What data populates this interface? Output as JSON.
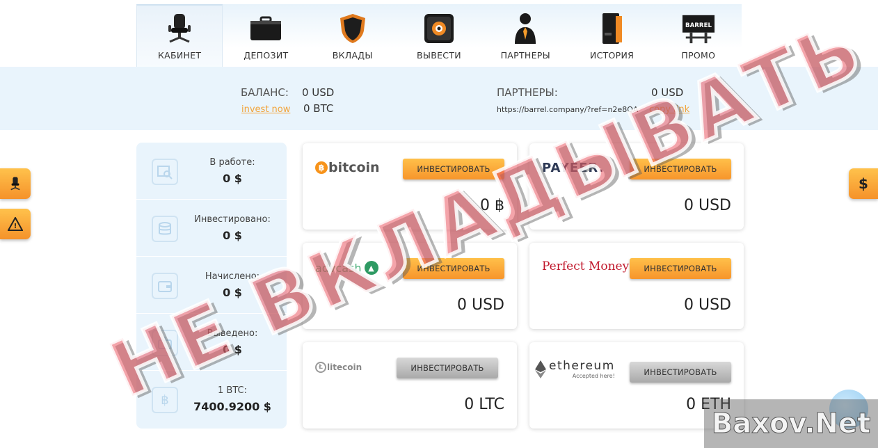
{
  "nav": {
    "items": [
      {
        "label": "КАБИНЕТ",
        "icon": "office-chair-icon",
        "active": true
      },
      {
        "label": "ДЕПОЗИТ",
        "icon": "briefcase-icon"
      },
      {
        "label": "ВКЛАДЫ",
        "icon": "shield-icon"
      },
      {
        "label": "ВЫВЕСТИ",
        "icon": "safe-icon"
      },
      {
        "label": "ПАРТНЕРЫ",
        "icon": "person-tie-icon"
      },
      {
        "label": "ИСТОРИЯ",
        "icon": "binder-icon"
      },
      {
        "label": "ПРОМО",
        "icon": "billboard-icon",
        "billboard_text": "BARREL"
      }
    ]
  },
  "balance": {
    "label": "БАЛАНС:",
    "usd": "0 USD",
    "btc": "0 BTC",
    "invest_link": "invest now"
  },
  "partners": {
    "label": "ПАРТНЕРЫ:",
    "usd": "0 USD",
    "ref_link": "https://barrel.company/?ref=n2e8QA",
    "copy_link": "copy link"
  },
  "stats": [
    {
      "label": "В работе:",
      "value": "0 $",
      "icon": "search-document-icon"
    },
    {
      "label": "Инвестировано:",
      "value": "0 $",
      "icon": "coins-icon"
    },
    {
      "label": "Начислено:",
      "value": "0 $",
      "icon": "wallet-icon"
    },
    {
      "label": "Выведено:",
      "value": "0 $",
      "icon": "withdraw-icon"
    },
    {
      "label": "1 BTC:",
      "value": "7400.9200 $",
      "icon": "bitcoin-icon"
    }
  ],
  "cards": [
    {
      "logo": "bitcoin",
      "button": "ИНВЕСТИРОВАТЬ",
      "amount": "0 ฿",
      "button_style": "orange"
    },
    {
      "logo": "PAYEER.",
      "button": "ИНВЕСТИРОВАТЬ",
      "amount": "0 USD",
      "button_style": "orange"
    },
    {
      "logo": "advcash",
      "button": "ИНВЕСТИРОВАТЬ",
      "amount": "0 USD",
      "button_style": "orange"
    },
    {
      "logo": "Perfect Money",
      "button": "ИНВЕСТИРОВАТЬ",
      "amount": "0 USD",
      "button_style": "orange"
    },
    {
      "logo": "litecoin",
      "button": "ИНВЕСТИРОВАТЬ",
      "amount": "0 LTC",
      "button_style": "gray"
    },
    {
      "logo": "ethereum",
      "logo_sub": "Accepted here!",
      "button": "ИНВЕСТИРОВАТЬ",
      "amount": "0 ETH",
      "button_style": "gray"
    }
  ],
  "side": {
    "left_top_icon": "office-chair-icon",
    "left_bottom_icon": "warning-icon",
    "left_bottom_text": "!",
    "right_text": "$"
  },
  "stamp_text": "НЕ ВКЛАДЫВАТЬ",
  "watermark_text": "Baxov.Net",
  "colors": {
    "accent": "#f7952b",
    "panel": "#e9f4fc",
    "stamp": "#eb5a64"
  }
}
